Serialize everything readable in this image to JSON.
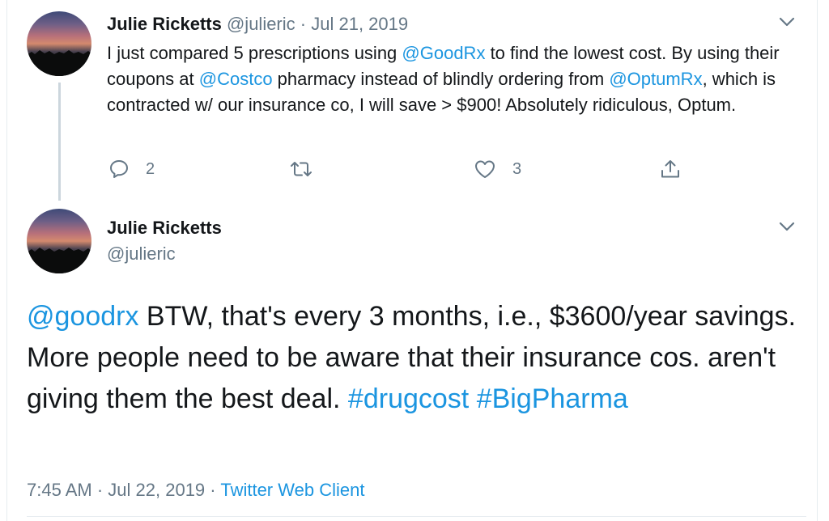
{
  "tweet1": {
    "name": "Julie Ricketts",
    "handle": "@julieric",
    "separator": "·",
    "date": "Jul 21, 2019",
    "text": {
      "p1": "I just compared 5 prescriptions using ",
      "m1": "@GoodRx",
      "p2": " to find the lowest cost. By using their coupons at ",
      "m2": "@Costco",
      "p3": " pharmacy instead of blindly ordering from ",
      "m3": "@OptumRx",
      "p4": ", which is contracted w/ our insurance co, I will save > $900! Absolutely ridiculous, Optum."
    },
    "actions": {
      "reply_icon": "reply-icon",
      "reply_count": "2",
      "retweet_icon": "retweet-icon",
      "like_icon": "heart-icon",
      "like_count": "3",
      "share_icon": "share-icon"
    }
  },
  "tweet2": {
    "name": "Julie Ricketts",
    "handle": "@julieric",
    "text": {
      "m1": "@goodrx",
      "p1": " BTW, that's every 3 months, i.e., $3600/year savings. More people need to be aware that their insurance cos. aren't giving them the best deal. ",
      "h1": "#drugcost",
      "h2": "#BigPharma"
    },
    "meta": {
      "time": "7:45 AM",
      "separator": "·",
      "date": "Jul 22, 2019",
      "client": "Twitter Web Client"
    }
  },
  "colors": {
    "link": "#1b95e0",
    "muted": "#657786",
    "text": "#14171a",
    "thread_line": "#ccd6dd"
  }
}
